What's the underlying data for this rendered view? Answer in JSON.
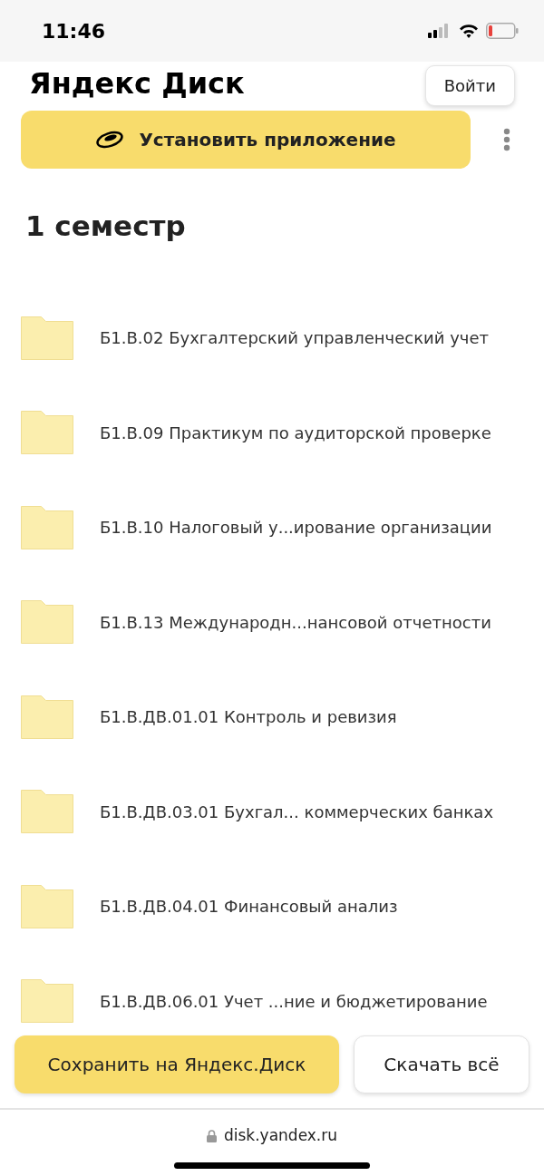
{
  "status_bar": {
    "time": "11:46"
  },
  "header": {
    "title": "Яндекс Диск",
    "login_button": "Войти"
  },
  "install_button": {
    "label": "Установить приложение"
  },
  "folder": {
    "title": "1 семестр"
  },
  "items": [
    {
      "name": "Б1.В.02 Бухгалтерский управленческий учет"
    },
    {
      "name": "Б1.В.09 Практикум по аудиторской проверке"
    },
    {
      "name": "Б1.В.10 Налоговый у...ирование организации"
    },
    {
      "name": "Б1.В.13 Международн...нансовой отчетности"
    },
    {
      "name": "Б1.В.ДВ.01.01 Контроль и ревизия"
    },
    {
      "name": "Б1.В.ДВ.03.01 Бухгал... коммерческих банках"
    },
    {
      "name": "Б1.В.ДВ.04.01 Финансовый анализ"
    },
    {
      "name": "Б1.В.ДВ.06.01 Учет ...ние и бюджетирование"
    }
  ],
  "actions": {
    "save": "Сохранить на Яндекс.Диск",
    "download": "Скачать всё"
  },
  "browser": {
    "url": "disk.yandex.ru"
  }
}
